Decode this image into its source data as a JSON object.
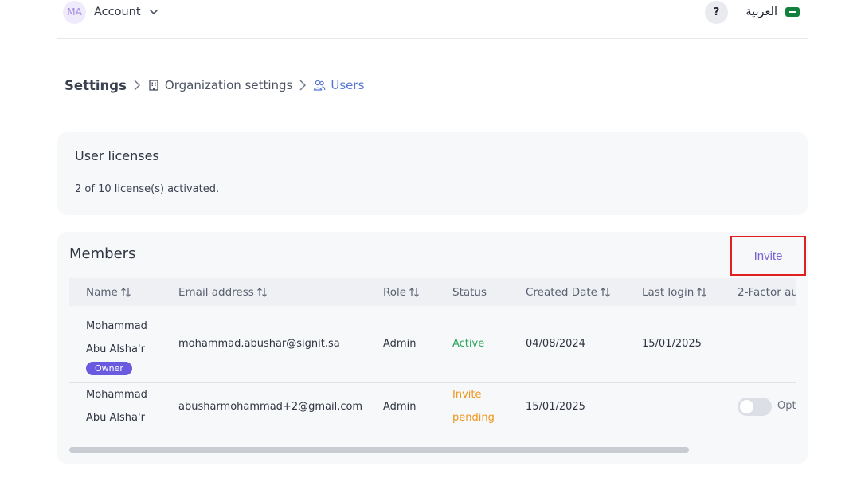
{
  "header": {
    "avatar_initials": "MA",
    "account_label": "Account",
    "help_label": "?",
    "language_label": "العربية"
  },
  "breadcrumb": {
    "settings": "Settings",
    "organization": "Organization settings",
    "users": "Users"
  },
  "licenses": {
    "title": "User licenses",
    "text": "2 of 10 license(s) activated."
  },
  "members": {
    "title": "Members",
    "invite_label": "Invite",
    "columns": {
      "name": "Name",
      "email": "Email address",
      "role": "Role",
      "status": "Status",
      "created": "Created Date",
      "last_login": "Last login",
      "two_factor": "2-Factor au"
    },
    "rows": [
      {
        "first_name": "Mohammad",
        "last_name": "Abu Alsha'r",
        "badge": "Owner",
        "email": "mohammad.abushar@signit.sa",
        "role": "Admin",
        "status": "Active",
        "created": "04/08/2024",
        "last_login": "15/01/2025"
      },
      {
        "first_name": "Mohammad",
        "last_name": "Abu Alsha'r",
        "email": "abusharmohammad+2@gmail.com",
        "role": "Admin",
        "status_line1": "Invite",
        "status_line2": "pending",
        "created": "15/01/2025",
        "two_factor_text": "Opt"
      }
    ]
  },
  "colors": {
    "accent": "#5476d8",
    "invite": "#7a63d6",
    "active": "#2aa85c",
    "pending": "#f0961c",
    "owner_badge": "#6a5ae0",
    "highlight_border": "#e02020"
  }
}
